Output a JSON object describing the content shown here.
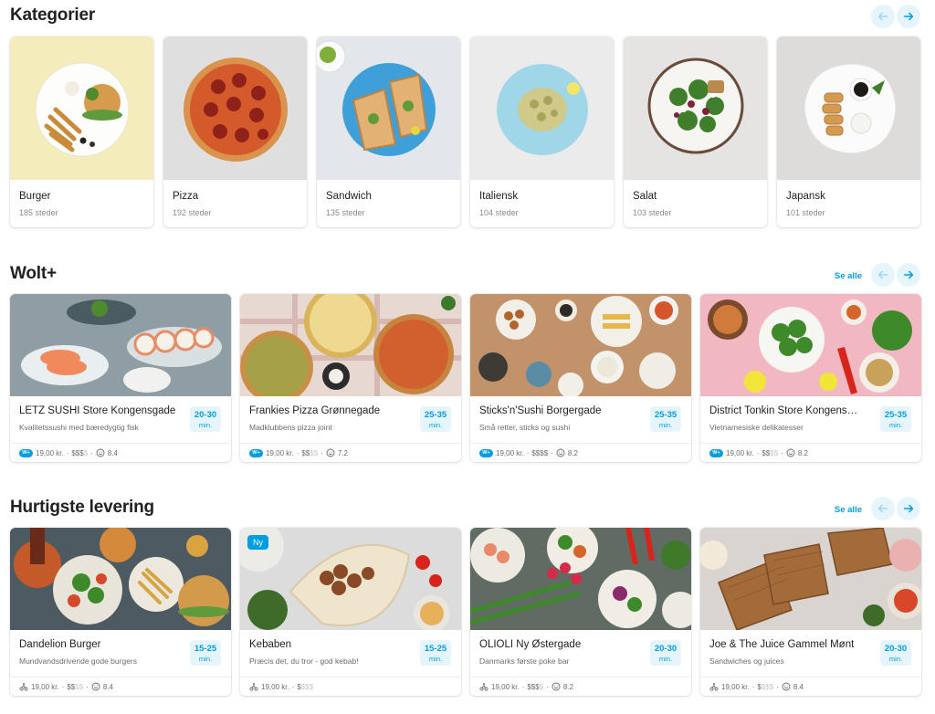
{
  "sections": {
    "categories": {
      "title": "Kategorier",
      "items": [
        {
          "name": "Burger",
          "count": "185 steder"
        },
        {
          "name": "Pizza",
          "count": "192 steder"
        },
        {
          "name": "Sandwich",
          "count": "135 steder"
        },
        {
          "name": "Italiensk",
          "count": "104 steder"
        },
        {
          "name": "Salat",
          "count": "103 steder"
        },
        {
          "name": "Japansk",
          "count": "101 steder"
        }
      ]
    },
    "wolt_plus": {
      "title": "Wolt+",
      "see_all": "Se alle",
      "items": [
        {
          "name": "LETZ SUSHI Store Kongensgade",
          "desc": "Kvalitetssushi med bæredygtig fisk",
          "eta": "20-30",
          "unit": "min.",
          "fee": "19,00 kr.",
          "price_on": "$$$",
          "price_off": "$",
          "rating": "8.4",
          "badge": "W+"
        },
        {
          "name": "Frankies Pizza Grønnegade",
          "desc": "Madklubbens pizza joint",
          "eta": "25-35",
          "unit": "min.",
          "fee": "19,00 kr.",
          "price_on": "$$",
          "price_off": "$$",
          "rating": "7.2",
          "badge": "W+"
        },
        {
          "name": "Sticks'n'Sushi Borgergade",
          "desc": "Små retter, sticks og sushi",
          "eta": "25-35",
          "unit": "min.",
          "fee": "19,00 kr.",
          "price_on": "$$$$",
          "price_off": "",
          "rating": "8.2",
          "badge": "W+"
        },
        {
          "name": "District Tonkin Store Kongens…",
          "desc": "Vietnamesiske delikatesser",
          "eta": "25-35",
          "unit": "min.",
          "fee": "19,00 kr.",
          "price_on": "$$",
          "price_off": "$$",
          "rating": "8.2",
          "badge": "W+"
        }
      ]
    },
    "fastest": {
      "title": "Hurtigste levering",
      "see_all": "Se alle",
      "items": [
        {
          "name": "Dandelion Burger",
          "desc": "Mundvandsdrivende gode burgers",
          "eta": "15-25",
          "unit": "min.",
          "fee": "19,00 kr.",
          "price_on": "$$",
          "price_off": "$$",
          "rating": "8.4",
          "new": ""
        },
        {
          "name": "Kebaben",
          "desc": "Præcis det, du tror - god kebab!",
          "eta": "15-25",
          "unit": "min.",
          "fee": "19,00 kr.",
          "price_on": "$",
          "price_off": "$$$",
          "rating": "",
          "new": "Ny"
        },
        {
          "name": "OLIOLI Ny Østergade",
          "desc": "Danmarks første poke bar",
          "eta": "20-30",
          "unit": "min.",
          "fee": "19,00 kr.",
          "price_on": "$$$",
          "price_off": "$",
          "rating": "8.2",
          "new": ""
        },
        {
          "name": "Joe & The Juice Gammel Mønt",
          "desc": "Sandwiches og juices",
          "eta": "20-30",
          "unit": "min.",
          "fee": "19,00 kr.",
          "price_on": "$",
          "price_off": "$$$",
          "rating": "8.4",
          "new": ""
        }
      ]
    }
  },
  "colors": {
    "accent": "#009de0",
    "accent_light": "#e6f5fc",
    "text": "#202125",
    "muted": "#6b6b6b"
  },
  "icons": {
    "prev": "arrow-left-icon",
    "next": "arrow-right-icon",
    "rating": "smiley-icon",
    "delivery": "courier-icon"
  }
}
